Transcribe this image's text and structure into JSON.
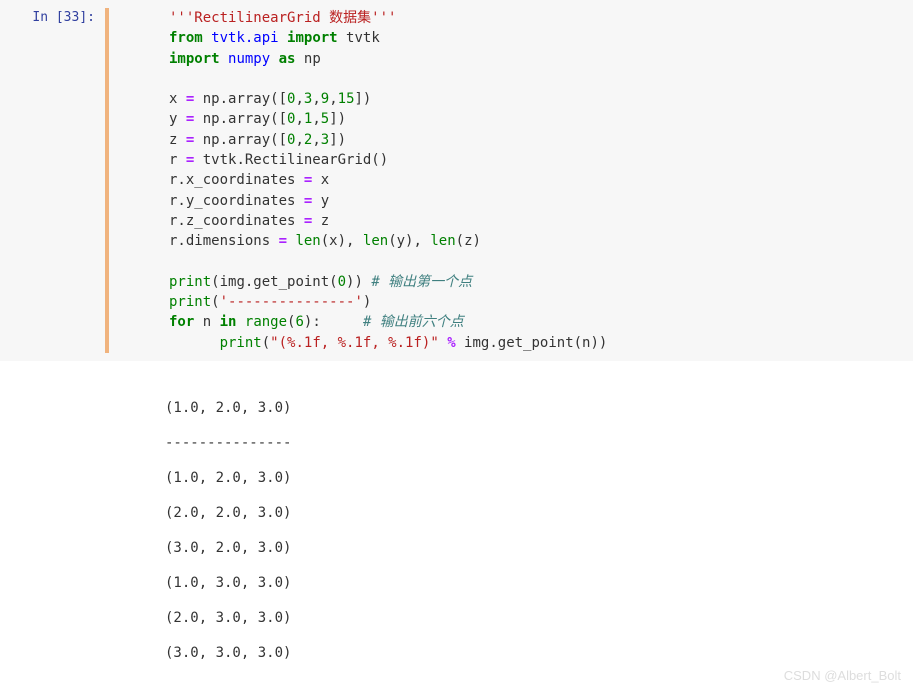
{
  "prompt": "In [33]:",
  "code": {
    "l1_doc": "'''RectilinearGrid 数据集'''",
    "l2_from": "from",
    "l2_mod": "tvtk.api",
    "l2_import": "import",
    "l2_name": "tvtk",
    "l3_import": "import",
    "l3_mod": "numpy",
    "l3_as": "as",
    "l3_name": "np",
    "l5_x": "x ",
    "l5_eq": "=",
    "l5_call": " np.array([",
    "l5_n0": "0",
    "l5_n1": "3",
    "l5_n2": "9",
    "l5_n3": "15",
    "l5_close": "])",
    "l6_y": "y ",
    "l6_eq": "=",
    "l6_call": " np.array([",
    "l6_n0": "0",
    "l6_n1": "1",
    "l6_n2": "5",
    "l6_close": "])",
    "l7_z": "z ",
    "l7_eq": "=",
    "l7_call": " np.array([",
    "l7_n0": "0",
    "l7_n1": "2",
    "l7_n2": "3",
    "l7_close": "])",
    "l8_r": "r ",
    "l8_eq": "=",
    "l8_call": " tvtk.RectilinearGrid()",
    "l9_a": "r.x_coordinates ",
    "l9_eq": "=",
    "l9_b": " x",
    "l10_a": "r.y_coordinates ",
    "l10_eq": "=",
    "l10_b": " y",
    "l11_a": "r.z_coordinates ",
    "l11_eq": "=",
    "l11_b": " z",
    "l12_a": "r.dimensions ",
    "l12_eq": "=",
    "l12_b1": "len",
    "l12_b2": "(x), ",
    "l12_b3": "len",
    "l12_b4": "(y), ",
    "l12_b5": "len",
    "l12_b6": "(z)",
    "l14_print": "print",
    "l14_open": "(img.get_point(",
    "l14_n": "0",
    "l14_close": ")) ",
    "l14_cmt": "# 输出第一个点",
    "l15_print": "print",
    "l15_open": "(",
    "l15_str": "'---------------'",
    "l15_close": ")",
    "l16_for": "for",
    "l16_n": " n ",
    "l16_in": "in",
    "l16_sp": " ",
    "l16_range": "range",
    "l16_args": "(",
    "l16_num": "6",
    "l16_close": "):     ",
    "l16_cmt": "# 输出前六个点",
    "l17_pad": "      ",
    "l17_print": "print",
    "l17_open": "(",
    "l17_str": "\"(%.1f, %.1f, %.1f)\"",
    "l17_sp": " ",
    "l17_pct": "%",
    "l17_rest": " img.get_point(n))"
  },
  "output": {
    "o1": "(1.0, 2.0, 3.0)",
    "o2": "---------------",
    "o3": "(1.0, 2.0, 3.0)",
    "o4": "(2.0, 2.0, 3.0)",
    "o5": "(3.0, 2.0, 3.0)",
    "o6": "(1.0, 3.0, 3.0)",
    "o7": "(2.0, 3.0, 3.0)",
    "o8": "(3.0, 3.0, 3.0)"
  },
  "watermark": "CSDN @Albert_Bolt"
}
